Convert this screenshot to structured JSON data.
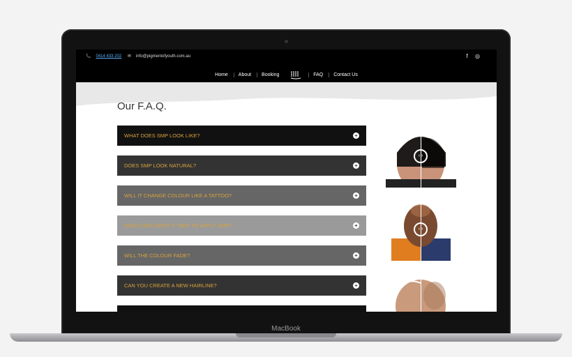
{
  "device": {
    "brand": "MacBook"
  },
  "site": {
    "phone": "0414 433 202",
    "email": "info@pigmentofyouth.com.au",
    "social": [
      "f",
      "◎"
    ],
    "nav": [
      "Home",
      "About",
      "Booking",
      "FAQ",
      "Contact Us"
    ]
  },
  "faq": {
    "title": "Our F.A.Q.",
    "items": [
      {
        "q": "WHAT DOES SMP LOOK LIKE?",
        "bg": "#111111"
      },
      {
        "q": "DOES SMP LOOK NATURAL?",
        "bg": "#333333"
      },
      {
        "q": "WILL IT CHANGE COLOUR LIKE A TATTOO?",
        "bg": "#666666"
      },
      {
        "q": "HOW LONG DOES IT TAKE TO APPLY SMP?",
        "bg": "#9a9a9a"
      },
      {
        "q": "WILL THE COLOUR FADE?",
        "bg": "#666666"
      },
      {
        "q": "CAN YOU CREATE A NEW HAIRLINE?",
        "bg": "#333333"
      },
      {
        "q": "",
        "bg": "#111111"
      }
    ]
  },
  "images": [
    "before-after-1",
    "before-after-2",
    "before-after-3"
  ]
}
